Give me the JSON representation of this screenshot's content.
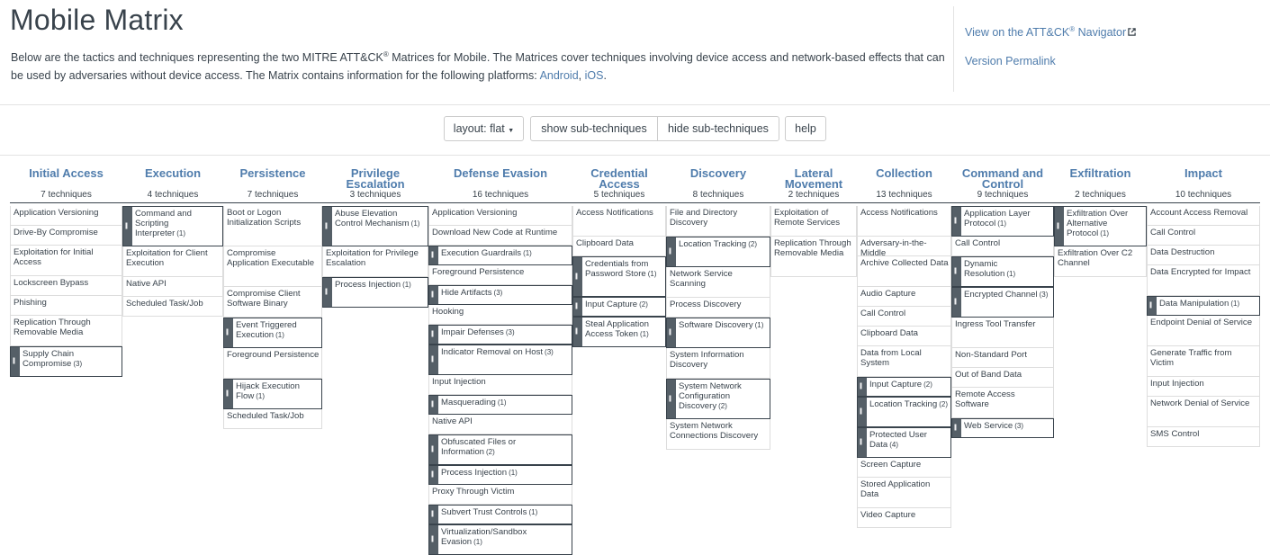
{
  "header": {
    "title": "Mobile Matrix",
    "desc_1": "Below are the tactics and techniques representing the two MITRE ATT&CK",
    "desc_reg": "®",
    "desc_2": " Matrices for Mobile. The Matrices cover techniques involving device access and network-based effects that can be used by adversaries without device access. The Matrix contains information for the following platforms: ",
    "platform_1": "Android",
    "platform_sep": ", ",
    "platform_2": "iOS",
    "desc_end": "."
  },
  "side_links": {
    "navigator_1": "View on the ATT&CK",
    "navigator_reg": "®",
    "navigator_2": " Navigator",
    "external_icon": "external-link-icon",
    "permalink": "Version Permalink"
  },
  "toolbar": {
    "layout": "layout: flat",
    "show_sub": "show sub-techniques",
    "hide_sub": "hide sub-techniques",
    "help": "help"
  },
  "tactics": [
    {
      "name": "Initial Access",
      "count": "7 techniques",
      "techniques": [
        {
          "name": "Application Versioning",
          "sub": false
        },
        {
          "name": "Drive-By Compromise",
          "sub": false
        },
        {
          "name": "Exploitation for Initial Access",
          "sub": false
        },
        {
          "name": "Lockscreen Bypass",
          "sub": false
        },
        {
          "name": "Phishing",
          "sub": false
        },
        {
          "name": "Replication Through Removable Media",
          "sub": false
        },
        {
          "name": "Supply Chain Compromise",
          "sub": true,
          "count": "(3)"
        }
      ]
    },
    {
      "name": "Execution",
      "count": "4 techniques",
      "techniques": [
        {
          "name": "Command and Scripting Interpreter",
          "sub": true,
          "count": "(1)"
        },
        {
          "name": "Exploitation for Client Execution",
          "sub": false
        },
        {
          "name": "Native API",
          "sub": false
        },
        {
          "name": "Scheduled Task/Job",
          "sub": false
        }
      ]
    },
    {
      "name": "Persistence",
      "count": "7 techniques",
      "techniques": [
        {
          "name": "Boot or Logon Initialization Scripts",
          "sub": false
        },
        {
          "name": "Compromise Application Executable",
          "sub": false
        },
        {
          "name": "Compromise Client Software Binary",
          "sub": false
        },
        {
          "name": "Event Triggered Execution",
          "sub": true,
          "count": "(1)"
        },
        {
          "name": "Foreground Persistence",
          "sub": false
        },
        {
          "name": "Hijack Execution Flow",
          "sub": true,
          "count": "(1)"
        },
        {
          "name": "Scheduled Task/Job",
          "sub": false
        }
      ]
    },
    {
      "name": "Privilege Escalation",
      "count": "3 techniques",
      "techniques": [
        {
          "name": "Abuse Elevation Control Mechanism",
          "sub": true,
          "count": "(1)"
        },
        {
          "name": "Exploitation for Privilege Escalation",
          "sub": false
        },
        {
          "name": "Process Injection",
          "sub": true,
          "count": "(1)"
        }
      ]
    },
    {
      "name": "Defense Evasion",
      "count": "16 techniques",
      "techniques": [
        {
          "name": "Application Versioning",
          "sub": false
        },
        {
          "name": "Download New Code at Runtime",
          "sub": false
        },
        {
          "name": "Execution Guardrails",
          "sub": true,
          "count": "(1)"
        },
        {
          "name": "Foreground Persistence",
          "sub": false
        },
        {
          "name": "Hide Artifacts",
          "sub": true,
          "count": "(3)"
        },
        {
          "name": "Hooking",
          "sub": false
        },
        {
          "name": "Impair Defenses",
          "sub": true,
          "count": "(3)"
        },
        {
          "name": "Indicator Removal on Host",
          "sub": true,
          "count": "(3)"
        },
        {
          "name": "Input Injection",
          "sub": false
        },
        {
          "name": "Masquerading",
          "sub": true,
          "count": "(1)"
        },
        {
          "name": "Native API",
          "sub": false
        },
        {
          "name": "Obfuscated Files or Information",
          "sub": true,
          "count": "(2)"
        },
        {
          "name": "Process Injection",
          "sub": true,
          "count": "(1)"
        },
        {
          "name": "Proxy Through Victim",
          "sub": false
        },
        {
          "name": "Subvert Trust Controls",
          "sub": true,
          "count": "(1)"
        },
        {
          "name": "Virtualization/Sandbox Evasion",
          "sub": true,
          "count": "(1)"
        }
      ]
    },
    {
      "name": "Credential Access",
      "count": "5 techniques",
      "techniques": [
        {
          "name": "Access Notifications",
          "sub": false
        },
        {
          "name": "Clipboard Data",
          "sub": false
        },
        {
          "name": "Credentials from Password Store",
          "sub": true,
          "count": "(1)"
        },
        {
          "name": "Input Capture",
          "sub": true,
          "count": "(2)"
        },
        {
          "name": "Steal Application Access Token",
          "sub": true,
          "count": "(1)"
        }
      ]
    },
    {
      "name": "Discovery",
      "count": "8 techniques",
      "techniques": [
        {
          "name": "File and Directory Discovery",
          "sub": false
        },
        {
          "name": "Location Tracking",
          "sub": true,
          "count": "(2)"
        },
        {
          "name": "Network Service Scanning",
          "sub": false
        },
        {
          "name": "Process Discovery",
          "sub": false
        },
        {
          "name": "Software Discovery",
          "sub": true,
          "count": "(1)"
        },
        {
          "name": "System Information Discovery",
          "sub": false
        },
        {
          "name": "System Network Configuration Discovery",
          "sub": true,
          "count": "(2)"
        },
        {
          "name": "System Network Connections Discovery",
          "sub": false
        }
      ]
    },
    {
      "name": "Lateral Movement",
      "count": "2 techniques",
      "techniques": [
        {
          "name": "Exploitation of Remote Services",
          "sub": false
        },
        {
          "name": "Replication Through Removable Media",
          "sub": false
        }
      ]
    },
    {
      "name": "Collection",
      "count": "13 techniques",
      "techniques": [
        {
          "name": "Access Notifications",
          "sub": false
        },
        {
          "name": "Adversary-in-the-Middle",
          "sub": false
        },
        {
          "name": "Archive Collected Data",
          "sub": false
        },
        {
          "name": "Audio Capture",
          "sub": false
        },
        {
          "name": "Call Control",
          "sub": false
        },
        {
          "name": "Clipboard Data",
          "sub": false
        },
        {
          "name": "Data from Local System",
          "sub": false
        },
        {
          "name": "Input Capture",
          "sub": true,
          "count": "(2)"
        },
        {
          "name": "Location Tracking",
          "sub": true,
          "count": "(2)"
        },
        {
          "name": "Protected User Data",
          "sub": true,
          "count": "(4)"
        },
        {
          "name": "Screen Capture",
          "sub": false
        },
        {
          "name": "Stored Application Data",
          "sub": false
        },
        {
          "name": "Video Capture",
          "sub": false
        }
      ]
    },
    {
      "name": "Command and Control",
      "count": "9 techniques",
      "techniques": [
        {
          "name": "Application Layer Protocol",
          "sub": true,
          "count": "(1)"
        },
        {
          "name": "Call Control",
          "sub": false
        },
        {
          "name": "Dynamic Resolution",
          "sub": true,
          "count": "(1)"
        },
        {
          "name": "Encrypted Channel",
          "sub": true,
          "count": "(3)"
        },
        {
          "name": "Ingress Tool Transfer",
          "sub": false
        },
        {
          "name": "Non-Standard Port",
          "sub": false
        },
        {
          "name": "Out of Band Data",
          "sub": false
        },
        {
          "name": "Remote Access Software",
          "sub": false
        },
        {
          "name": "Web Service",
          "sub": true,
          "count": "(3)"
        }
      ]
    },
    {
      "name": "Exfiltration",
      "count": "2 techniques",
      "techniques": [
        {
          "name": "Exfiltration Over Alternative Protocol",
          "sub": true,
          "count": "(1)"
        },
        {
          "name": "Exfiltration Over C2 Channel",
          "sub": false
        }
      ]
    },
    {
      "name": "Impact",
      "count": "10 techniques",
      "techniques": [
        {
          "name": "Account Access Removal",
          "sub": false
        },
        {
          "name": "Call Control",
          "sub": false
        },
        {
          "name": "Data Destruction",
          "sub": false
        },
        {
          "name": "Data Encrypted for Impact",
          "sub": false
        },
        {
          "name": "Data Manipulation",
          "sub": true,
          "count": "(1)"
        },
        {
          "name": "Endpoint Denial of Service",
          "sub": false
        },
        {
          "name": "Generate Traffic from Victim",
          "sub": false
        },
        {
          "name": "Input Injection",
          "sub": false
        },
        {
          "name": "Network Denial of Service",
          "sub": false
        },
        {
          "name": "SMS Control",
          "sub": false
        }
      ]
    }
  ]
}
